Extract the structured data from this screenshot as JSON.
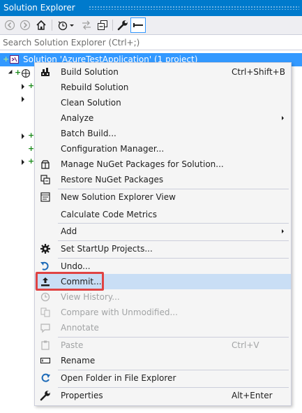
{
  "window": {
    "title": "Solution Explorer"
  },
  "toolbar": {
    "buttons": [
      {
        "icon": "back-icon"
      },
      {
        "icon": "forward-icon"
      },
      {
        "icon": "home-icon"
      },
      {
        "icon": "pending-changes-filter-icon"
      },
      {
        "icon": "sync-icon"
      },
      {
        "icon": "collapse-all-icon"
      },
      {
        "icon": "properties-wrench-icon"
      },
      {
        "icon": "preview-selected-icon"
      }
    ]
  },
  "search": {
    "placeholder": "Search Solution Explorer (Ctrl+;)",
    "value": ""
  },
  "tree": {
    "solution_label": "Solution 'AzureTestApplication' (1 project)"
  },
  "context_menu": {
    "items": [
      {
        "label": "Build Solution",
        "shortcut": "Ctrl+Shift+B",
        "icon": "build-icon"
      },
      {
        "label": "Rebuild Solution",
        "shortcut": ""
      },
      {
        "label": "Clean Solution",
        "shortcut": ""
      },
      {
        "label": "Analyze",
        "submenu": true
      },
      {
        "label": "Batch Build...",
        "shortcut": ""
      },
      {
        "label": "Configuration Manager...",
        "shortcut": ""
      },
      {
        "label": "Manage NuGet Packages for Solution...",
        "icon": "nuget-icon"
      },
      {
        "label": "Restore NuGet Packages",
        "icon": "restore-packages-icon"
      },
      {
        "label": "New Solution Explorer View",
        "icon": "new-view-icon"
      },
      {
        "label": "Calculate Code Metrics"
      },
      {
        "label": "Add",
        "submenu": true
      },
      {
        "label": "Set StartUp Projects...",
        "icon": "gear-icon"
      },
      {
        "label": "Undo...",
        "icon": "undo-icon"
      },
      {
        "label": "Commit...",
        "icon": "commit-icon",
        "highlighted": true
      },
      {
        "label": "View History...",
        "icon": "history-icon",
        "disabled": true
      },
      {
        "label": "Compare with Unmodified...",
        "icon": "compare-icon",
        "disabled": true
      },
      {
        "label": "Annotate",
        "icon": "annotate-icon",
        "disabled": true
      },
      {
        "label": "Paste",
        "shortcut": "Ctrl+V",
        "icon": "paste-icon",
        "disabled": true
      },
      {
        "label": "Rename",
        "icon": "rename-icon"
      },
      {
        "label": "Open Folder in File Explorer",
        "icon": "open-folder-icon"
      },
      {
        "label": "Properties",
        "shortcut": "Alt+Enter",
        "icon": "wrench-icon"
      }
    ]
  },
  "colors": {
    "title_bar": "#007acc",
    "selection": "#3399ff",
    "menu_highlight": "#c9def5",
    "annotation_border": "#e04343",
    "disabled_text": "#a2a4a5"
  }
}
